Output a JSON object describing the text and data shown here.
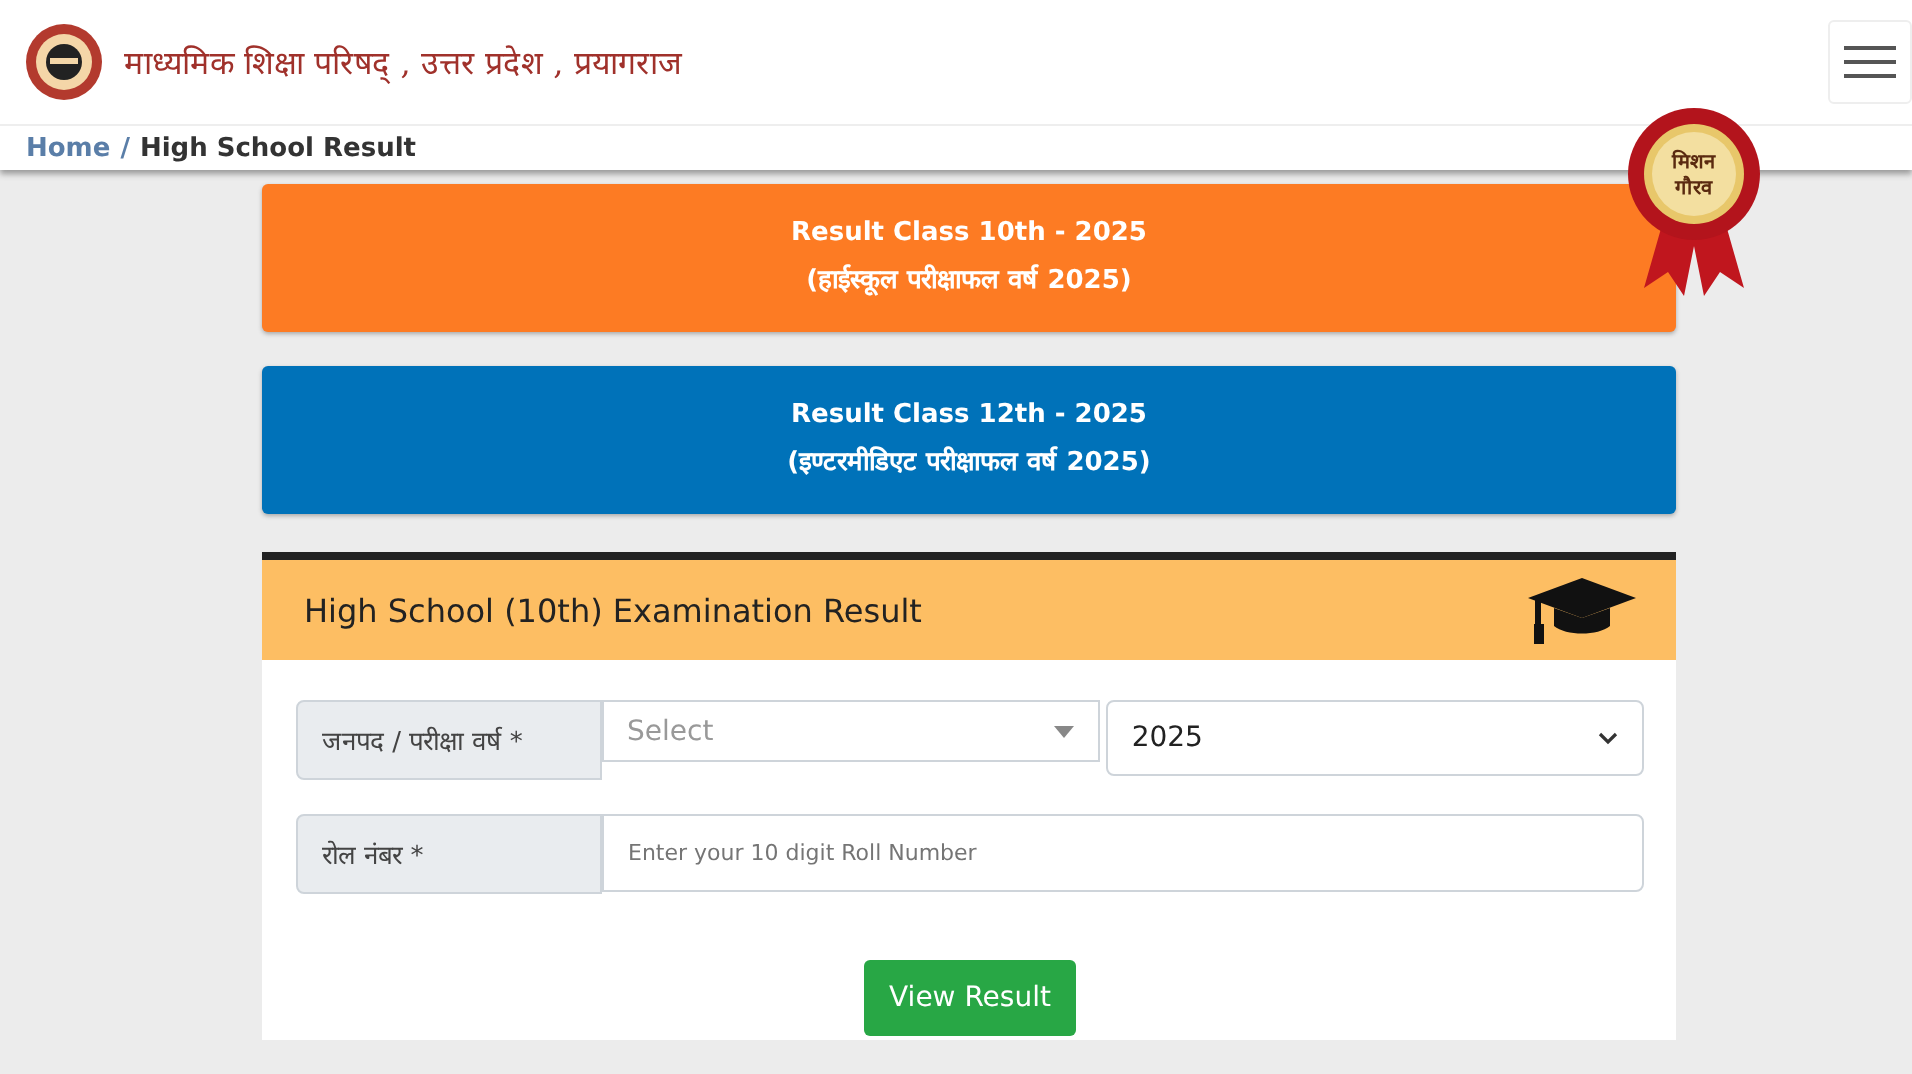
{
  "header": {
    "title": "माध्यमिक शिक्षा परिषद् , उत्तर प्रदेश , प्रयागराज"
  },
  "breadcrumb_separator": "/",
  "breadcrumb": [
    {
      "label": "Home",
      "kind": "link"
    },
    {
      "label": "High School Result",
      "kind": "current"
    }
  ],
  "badge": {
    "lines": [
      "मिशन",
      "गौरव"
    ]
  },
  "result_links": [
    {
      "line1": "Result Class 10th - 2025",
      "line2": "(हाईस्कूल परीक्षाफल वर्ष 2025)",
      "color": "#fd7b23"
    },
    {
      "line1": "Result Class 12th - 2025",
      "line2": "(इण्टरमीडिएट परीक्षाफल वर्ष 2025)",
      "color": "#0072b9"
    }
  ],
  "card": {
    "title": "High School (10th) Examination Result",
    "rows": [
      {
        "label": "जनपद / परीक्षा वर्ष *",
        "fields": [
          {
            "kind": "combo",
            "placeholder": "Select"
          },
          {
            "kind": "select",
            "value": "2025"
          }
        ]
      },
      {
        "label": "रोल नंबर *",
        "fields": [
          {
            "kind": "input",
            "placeholder": "Enter your 10 digit Roll Number"
          }
        ]
      }
    ],
    "button": "View Result"
  }
}
